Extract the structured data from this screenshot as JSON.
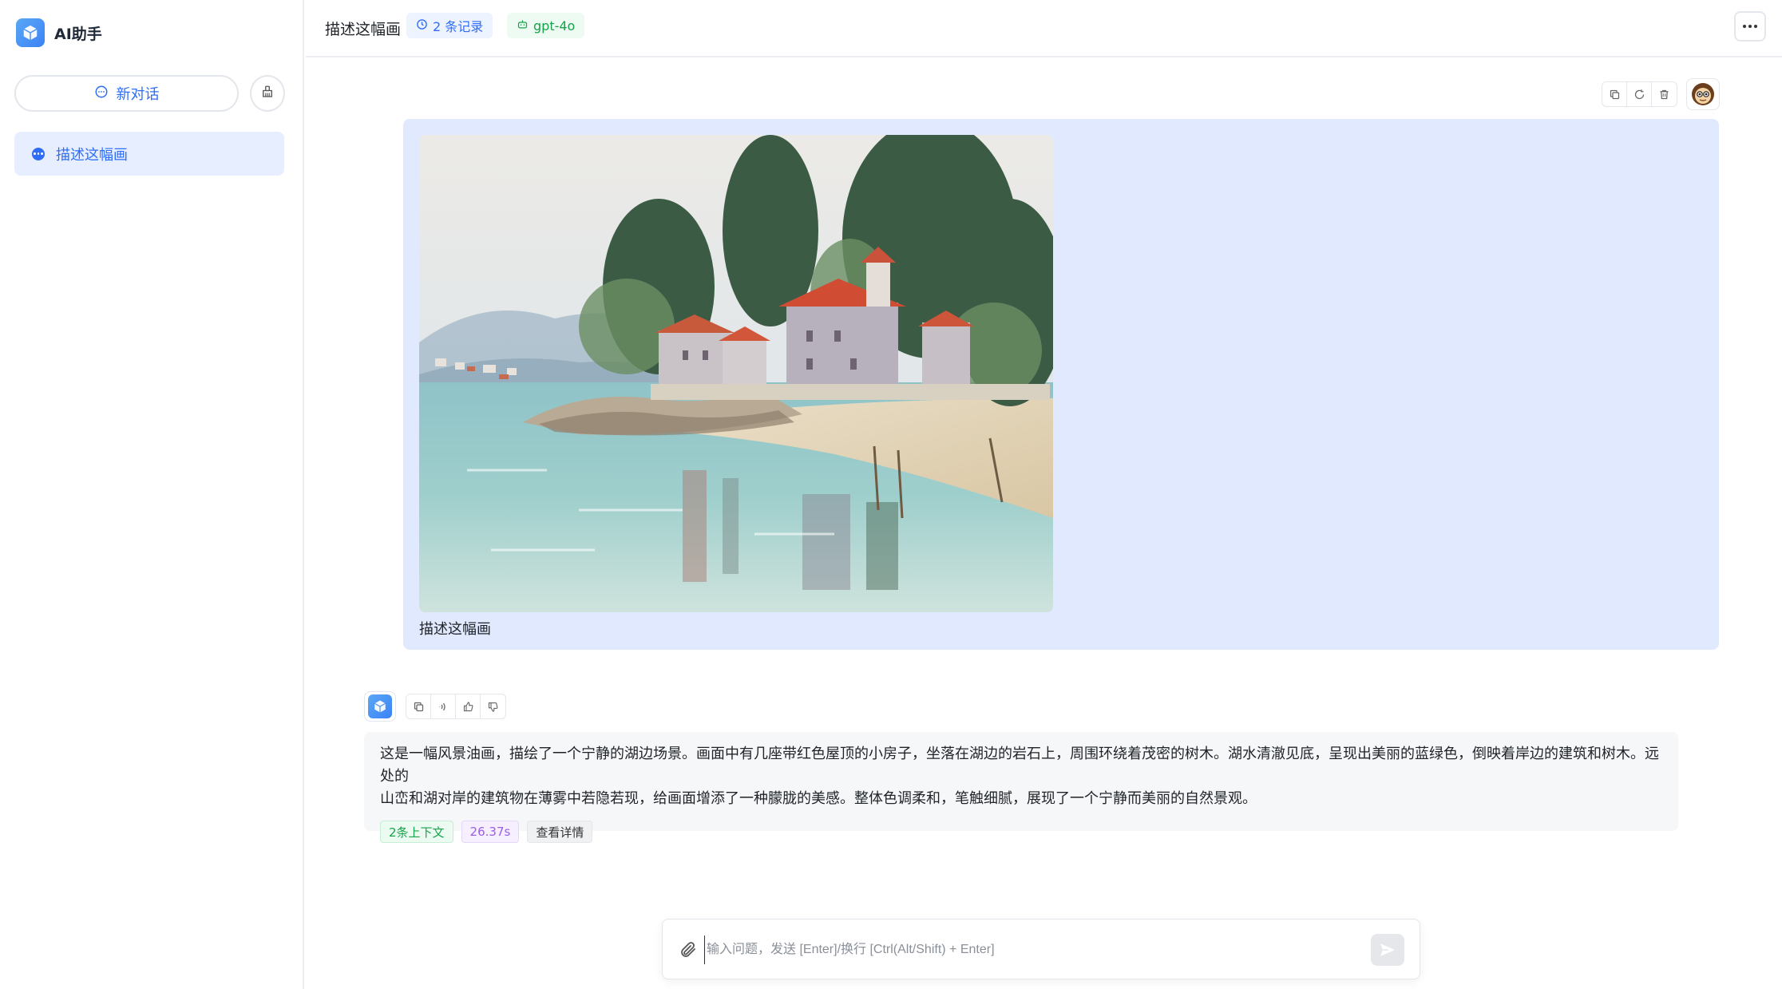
{
  "brand": {
    "name": "AI助手"
  },
  "sidebar": {
    "new_chat_label": "新对话",
    "conversations": [
      {
        "title": "描述这幅画",
        "active": true
      }
    ]
  },
  "header": {
    "title": "描述这幅画",
    "records_label": "2 条记录",
    "model_label": "gpt-4o"
  },
  "user_message": {
    "image_desc": "oil-painting-lakeside-houses",
    "text": "描述这幅画"
  },
  "ai_message": {
    "text_line1": "这是一幅风景油画，描绘了一个宁静的湖边场景。画面中有几座带红色屋顶的小房子，坐落在湖边的岩石上，周围环绕着茂密的树木。湖水清澈见底，呈现出美丽的蓝绿色，倒映着岸边的建筑和树木。远处的",
    "text_line2": "山峦和湖对岸的建筑物在薄雾中若隐若现，给画面增添了一种朦胧的美感。整体色调柔和，笔触细腻，展现了一个宁静而美丽的自然景观。",
    "context_tag": "2条上下文",
    "time_tag": "26.37s",
    "detail_label": "查看详情"
  },
  "input": {
    "placeholder": "输入问题，发送 [Enter]/换行 [Ctrl(Alt/Shift) + Enter]"
  },
  "colors": {
    "accent": "#2f6df6",
    "user_bubble": "#e1e9fe",
    "ai_bubble": "#f6f7f9",
    "model_green": "#16a34a",
    "time_purple": "#9b5de5"
  },
  "icons": [
    "app-logo-icon",
    "chat-bubble-icon",
    "clear-icon",
    "clock-icon",
    "robot-icon",
    "more-icon",
    "copy-icon",
    "regenerate-icon",
    "delete-icon",
    "user-avatar-icon",
    "speaker-icon",
    "thumbs-up-icon",
    "thumbs-down-icon",
    "paperclip-icon",
    "send-icon"
  ]
}
